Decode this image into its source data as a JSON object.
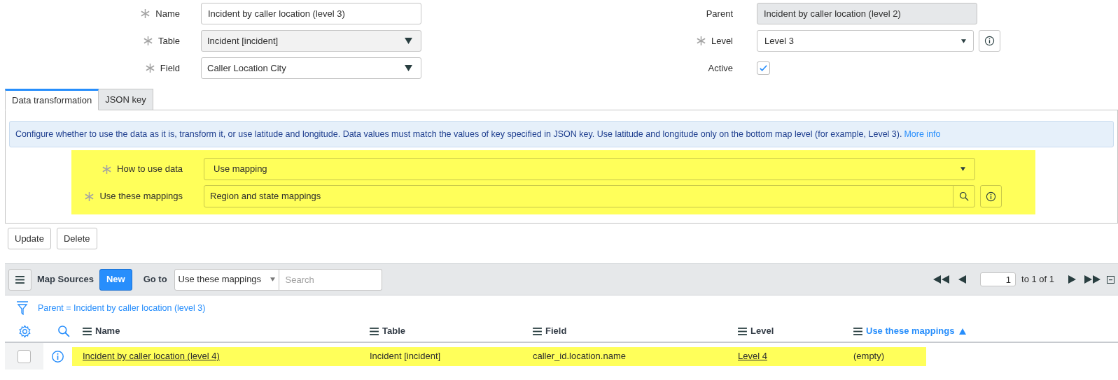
{
  "form": {
    "left": [
      {
        "label": "Name",
        "required": true,
        "kind": "text",
        "value": "Incident by caller location (level 3)",
        "readonly": false
      },
      {
        "label": "Table",
        "required": true,
        "kind": "select",
        "value": "Incident [incident]",
        "readonly": true
      },
      {
        "label": "Field",
        "required": true,
        "kind": "select",
        "value": "Caller Location City",
        "readonly": false
      }
    ],
    "right": [
      {
        "label": "Parent",
        "required": false,
        "kind": "text",
        "value": "Incident by caller location (level 2)",
        "readonly": true
      },
      {
        "label": "Level",
        "required": true,
        "kind": "choice",
        "value": "Level 3",
        "readonly": false
      },
      {
        "label": "Active",
        "required": false,
        "kind": "checkbox",
        "checked": true
      }
    ]
  },
  "tabs": [
    {
      "label": "Data transformation",
      "selected": true
    },
    {
      "label": "JSON key",
      "selected": false
    }
  ],
  "info": {
    "text": "Configure whether to use the data as it is, transform it, or use latitude and longitude. Data values must match the values of key specified in JSON key. Use latitude and longitude only on the bottom map level (for example, Level 3).",
    "link": "More info"
  },
  "transform": {
    "highlighted": true,
    "fields": [
      {
        "label": "How to use data",
        "required": true,
        "kind": "choice",
        "value": "Use mapping"
      },
      {
        "label": "Use these mappings",
        "required": true,
        "kind": "reference",
        "value": "Region and state mappings"
      }
    ]
  },
  "buttons": [
    "Update",
    "Delete"
  ],
  "related_list": {
    "title": "Map Sources",
    "new_button": "New",
    "goto_label": "Go to",
    "goto_field": "Use these mappings",
    "search_placeholder": "Search",
    "page": "1",
    "page_range": "to 1 of 1",
    "filter": "Parent = Incident by caller location (level 3)",
    "columns": [
      {
        "label": "Name",
        "sorted": false
      },
      {
        "label": "Table",
        "sorted": false
      },
      {
        "label": "Field",
        "sorted": false
      },
      {
        "label": "Level",
        "sorted": false
      },
      {
        "label": "Use these mappings",
        "sorted": true
      }
    ],
    "rows": [
      {
        "highlighted": true,
        "checked": false,
        "cells": [
          {
            "text": "Incident by caller location (level 4)",
            "link": true
          },
          {
            "text": "Incident [incident]",
            "link": false
          },
          {
            "text": "caller_id.location.name",
            "link": false
          },
          {
            "text": "Level 4",
            "link": true
          },
          {
            "text": "(empty)",
            "link": false
          }
        ]
      }
    ]
  }
}
